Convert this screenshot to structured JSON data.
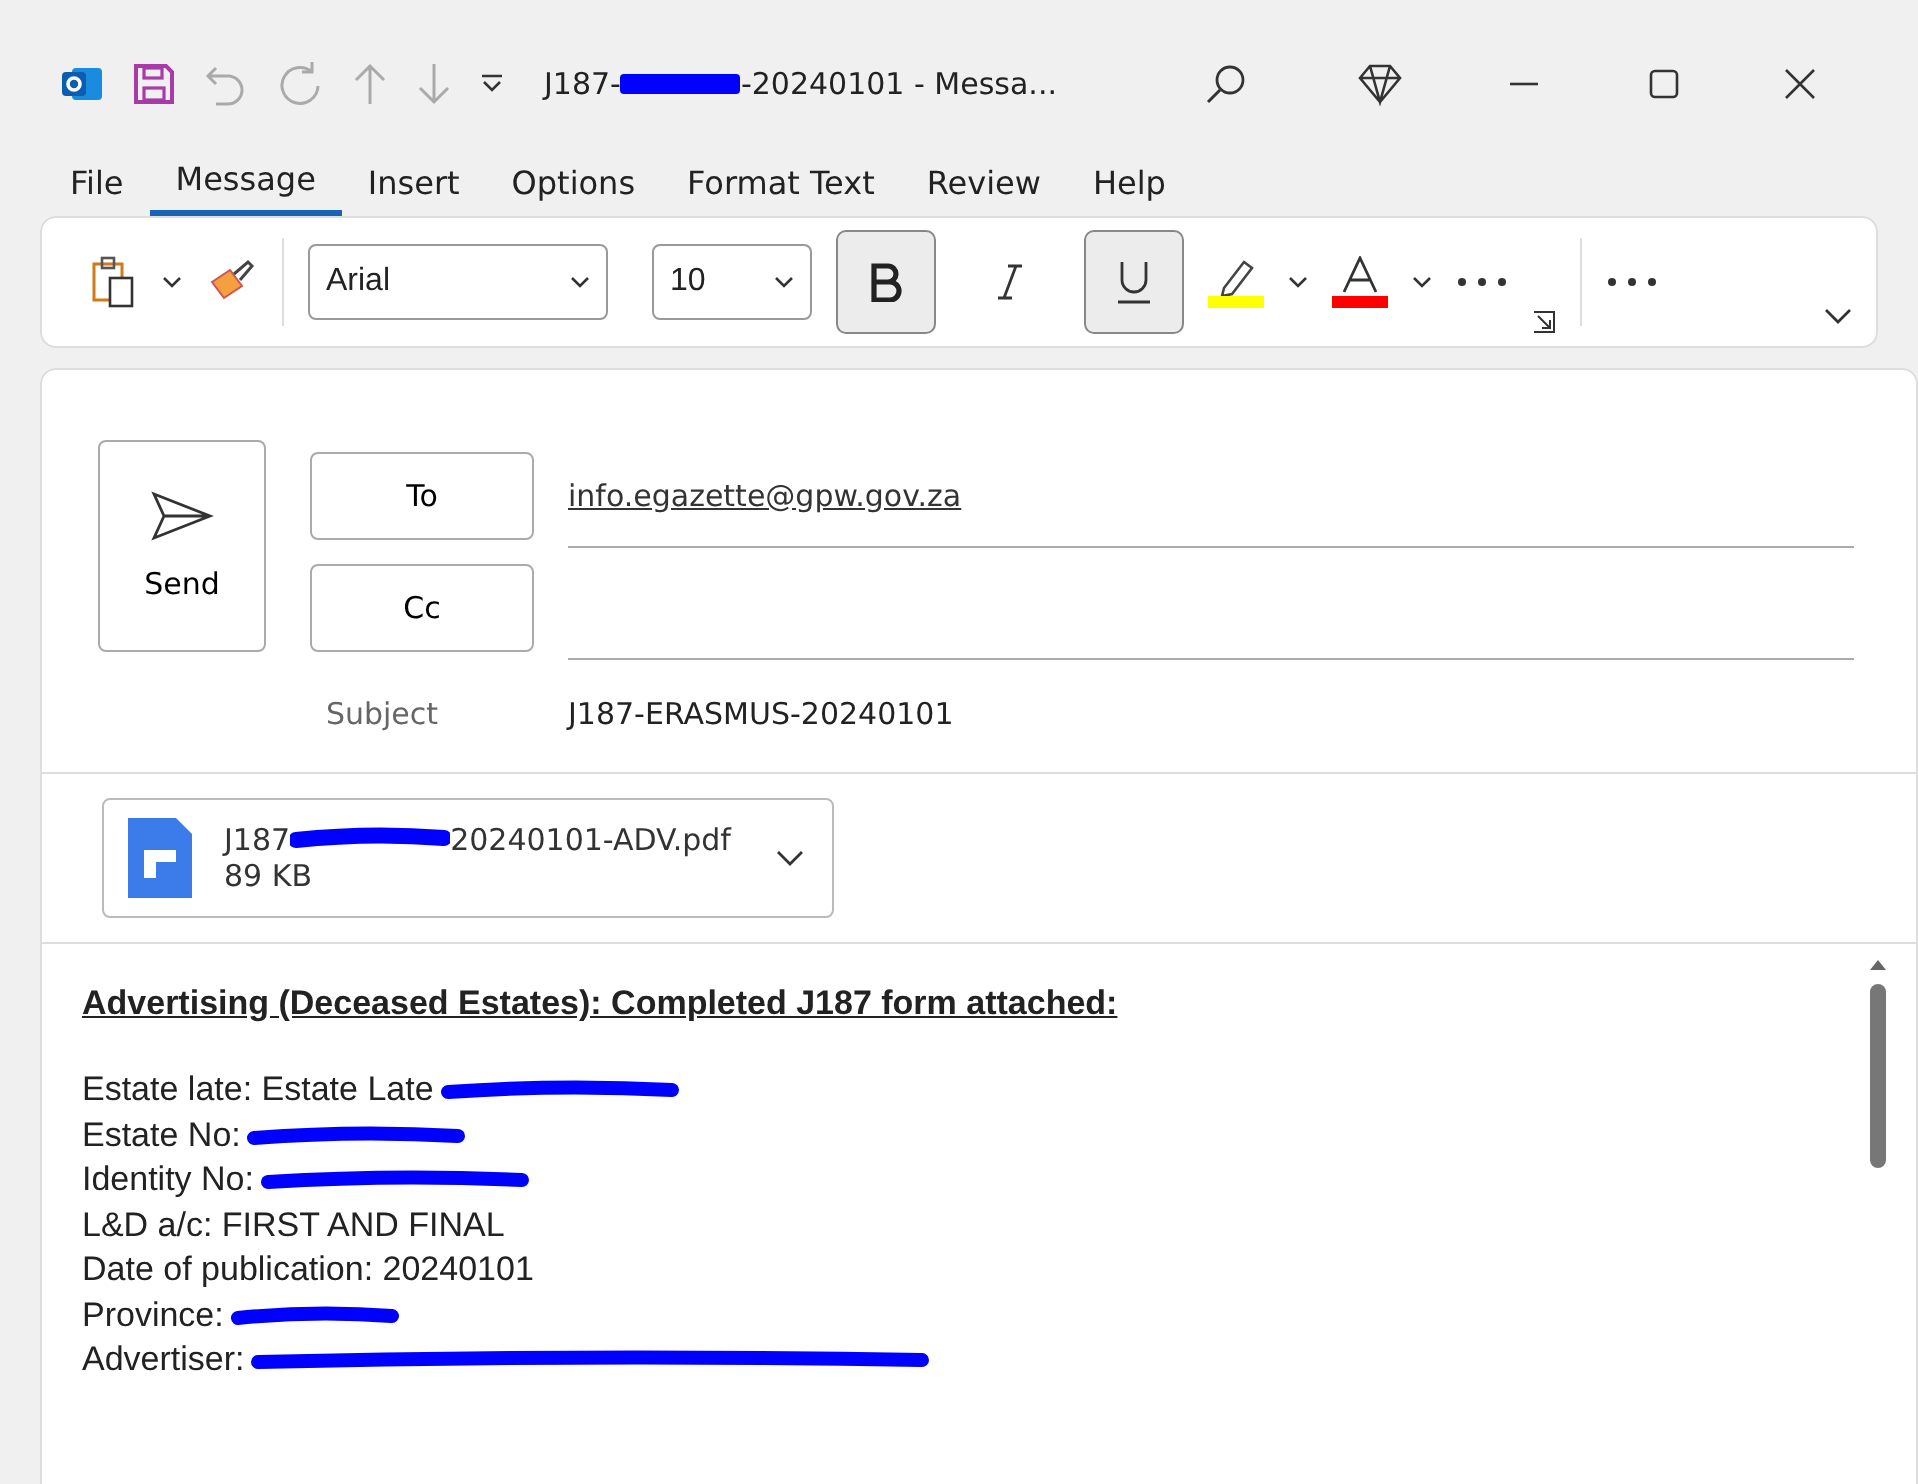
{
  "window": {
    "title": [
      {
        "kind": "text",
        "text": "J187-"
      },
      {
        "kind": "redaction"
      },
      {
        "kind": "text",
        "text": "-20240101  -  Messa..."
      }
    ]
  },
  "tabs": [
    {
      "label": "File",
      "selected": false
    },
    {
      "label": "Message",
      "selected": true
    },
    {
      "label": "Insert",
      "selected": false
    },
    {
      "label": "Options",
      "selected": false
    },
    {
      "label": "Format Text",
      "selected": false
    },
    {
      "label": "Review",
      "selected": false
    },
    {
      "label": "Help",
      "selected": false
    }
  ],
  "ribbon": {
    "font": "Arial",
    "size": "10",
    "bold": true,
    "italic": false,
    "underline": true
  },
  "compose": {
    "send": "Send",
    "to_button": "To",
    "cc_button": "Cc",
    "to": "info.egazette@gpw.gov.za",
    "subject_label": "Subject",
    "subject": "J187-ERASMUS-20240101"
  },
  "attachment": {
    "name": [
      {
        "kind": "text",
        "text": "J187"
      },
      {
        "kind": "redaction"
      },
      {
        "kind": "text",
        "text": "20240101-ADV.pdf"
      }
    ],
    "size": "89 KB"
  },
  "body": {
    "heading": "Advertising (Deceased Estates): Completed J187 form attached:",
    "lines": [
      {
        "text": "Estate late: Estate Late",
        "redacted": true
      },
      {
        "text": "Estate No:",
        "redacted": true
      },
      {
        "text": "Identity No:",
        "redacted": true
      },
      {
        "text": "L&D a/c: FIRST AND FINAL",
        "redacted": false
      },
      {
        "text": "Date of publication: 20240101",
        "redacted": false
      },
      {
        "text": "Province:",
        "redacted": true
      },
      {
        "text": "Advertiser:",
        "redacted": true
      }
    ]
  }
}
